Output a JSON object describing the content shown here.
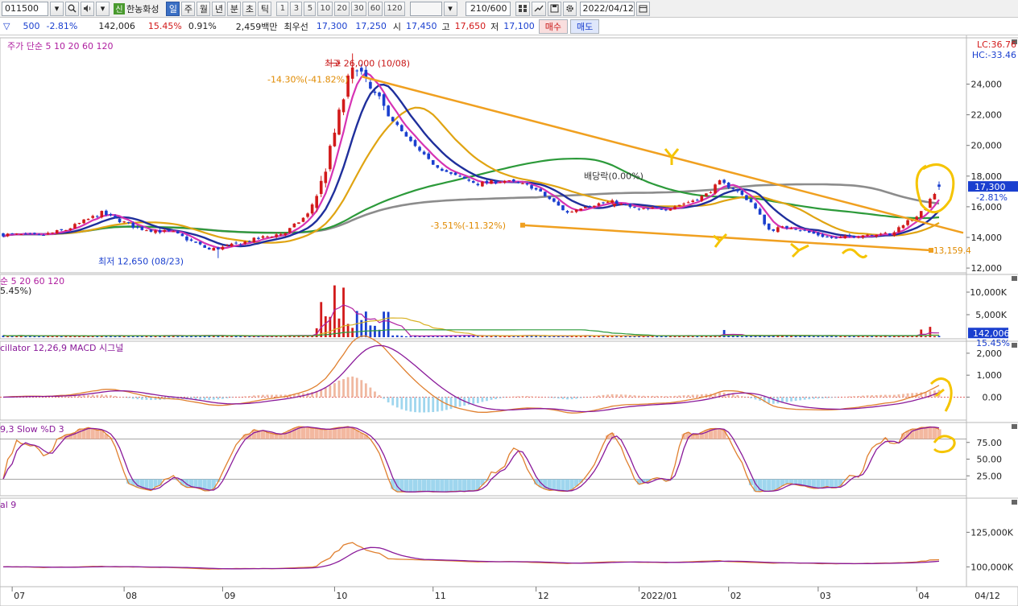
{
  "toolbar": {
    "code": "011500",
    "market_badge": "신",
    "stock_name": "한농화성",
    "periods": [
      "일",
      "주",
      "월",
      "년",
      "분",
      "초",
      "틱"
    ],
    "active_period": "일",
    "intervals": [
      "1",
      "3",
      "5",
      "10",
      "20",
      "30",
      "60",
      "120"
    ],
    "count": "210/600",
    "date": "2022/04/12"
  },
  "quote": {
    "arrow": "▽",
    "change": "500",
    "change_pct": "-2.81%",
    "volume": "142,006",
    "volume_ratio": "15.45%",
    "turnover": "0.91%",
    "amount": "2,459백만",
    "best_label": "최우선",
    "best_ask": "17,300",
    "best_bid": "17,250",
    "open_label": "시",
    "open": "17,450",
    "high_label": "고",
    "high": "17,650",
    "low_label": "저",
    "low": "17,100",
    "buy": "매수",
    "sell": "매도"
  },
  "chart_data": [
    {
      "type": "candlestick",
      "name": "price",
      "legend": "주가 단순 5  10  20  60  120",
      "ma_periods": [
        "5",
        "10",
        "20",
        "60",
        "120"
      ],
      "ma_colors": [
        "#d633b4",
        "#1f2f9c",
        "#e0a412",
        "#2c9a3a",
        "#8c8c8c"
      ],
      "y_ticks": [
        "24,000",
        "22,000",
        "20,000",
        "18,000",
        "16,000",
        "14,000",
        "12,000"
      ],
      "ylim": [
        11900,
        26600
      ],
      "x_ticks": [
        "07",
        "08",
        "09",
        "10",
        "11",
        "12",
        "2022/01",
        "02",
        "03",
        "04",
        "04/12"
      ],
      "lc": "LC:36.76",
      "hc": "HC:-33.46",
      "last_price": "17,300",
      "last_pct": "-2.81%",
      "annotations": {
        "high": "최고 26,000 (10/08)",
        "high_pct": "-14.30%(-41.82%)",
        "low": "최저 12,650 (08/23)",
        "support_pct": "-3.51%(-11.32%)",
        "support_end": "13,159.4",
        "dividend": "배당락(0.00%)"
      },
      "ohlc_summary": {
        "start_close": 14200,
        "peak": 26000,
        "peak_date": "10/08",
        "trough": 12650,
        "trough_date": "08/23",
        "last_close": 17300
      }
    },
    {
      "type": "bar",
      "name": "volume",
      "legend": "순 5  20  60  120",
      "legend_pct": "5.45%)",
      "y_ticks": [
        "10,000K",
        "5,000K"
      ],
      "last_volume": "142,006",
      "last_pct": "15.45%"
    },
    {
      "type": "line",
      "name": "macd",
      "legend": "cillator 12,26,9  MACD  시그널",
      "y_ticks": [
        "2,000",
        "1,000",
        "0.00"
      ],
      "ylim": [
        -900,
        2400
      ]
    },
    {
      "type": "line",
      "name": "stochastic",
      "legend": "9,3  Slow %D 3",
      "y_ticks": [
        "75.00",
        "50.00",
        "25.00"
      ],
      "ylim": [
        0,
        100
      ]
    },
    {
      "type": "line",
      "name": "obv",
      "legend": "al 9",
      "y_ticks": [
        "125,000K",
        "100,000K"
      ]
    }
  ]
}
